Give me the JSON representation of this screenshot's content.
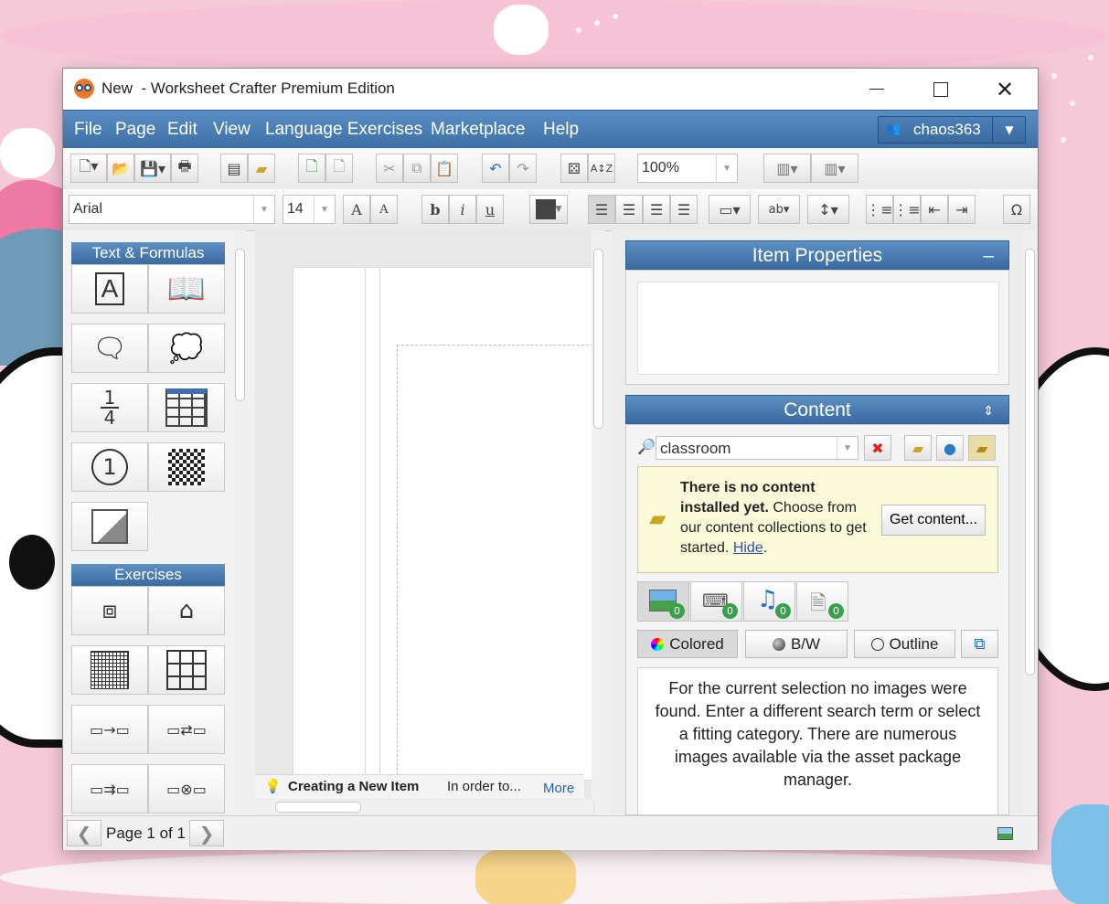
{
  "window": {
    "title": "New  - Worksheet Crafter Premium Edition"
  },
  "menu": {
    "items": [
      "File",
      "Page",
      "Edit",
      "View",
      "Language Exercises",
      "Marketplace",
      "Help"
    ],
    "user": "chaos363"
  },
  "toolbar": {
    "zoom": "100%",
    "font": "Arial",
    "font_size": "14"
  },
  "palette": {
    "section1": "Text & Formulas",
    "fraction_top": "1",
    "fraction_bottom": "4",
    "number_tile": "1",
    "section2": "Exercises"
  },
  "canvas": {
    "tip_title": "Creating a New Item",
    "tip_text": "In order to...",
    "tip_more": "More"
  },
  "item_properties": {
    "title": "Item Properties",
    "collapse": "–"
  },
  "content": {
    "title": "Content",
    "search_value": "classroom",
    "notice_bold": "There is no content installed yet.",
    "notice_text": " Choose from our content collections to get started. ",
    "notice_link": "Hide",
    "notice_end": ".",
    "get_content": "Get content...",
    "category_counts": [
      "0",
      "0",
      "0",
      "0"
    ],
    "modes": [
      "Colored",
      "B/W",
      "Outline"
    ],
    "result_text": "For the current selection no images were found. Enter a different search term or select a fitting category. There are numerous images available via the asset package manager."
  },
  "status": {
    "page_label": "Page 1 of 1"
  },
  "colors": {
    "accent": "#3c6ea4",
    "notice_bg": "#fafada",
    "badge": "#3aa04a"
  }
}
